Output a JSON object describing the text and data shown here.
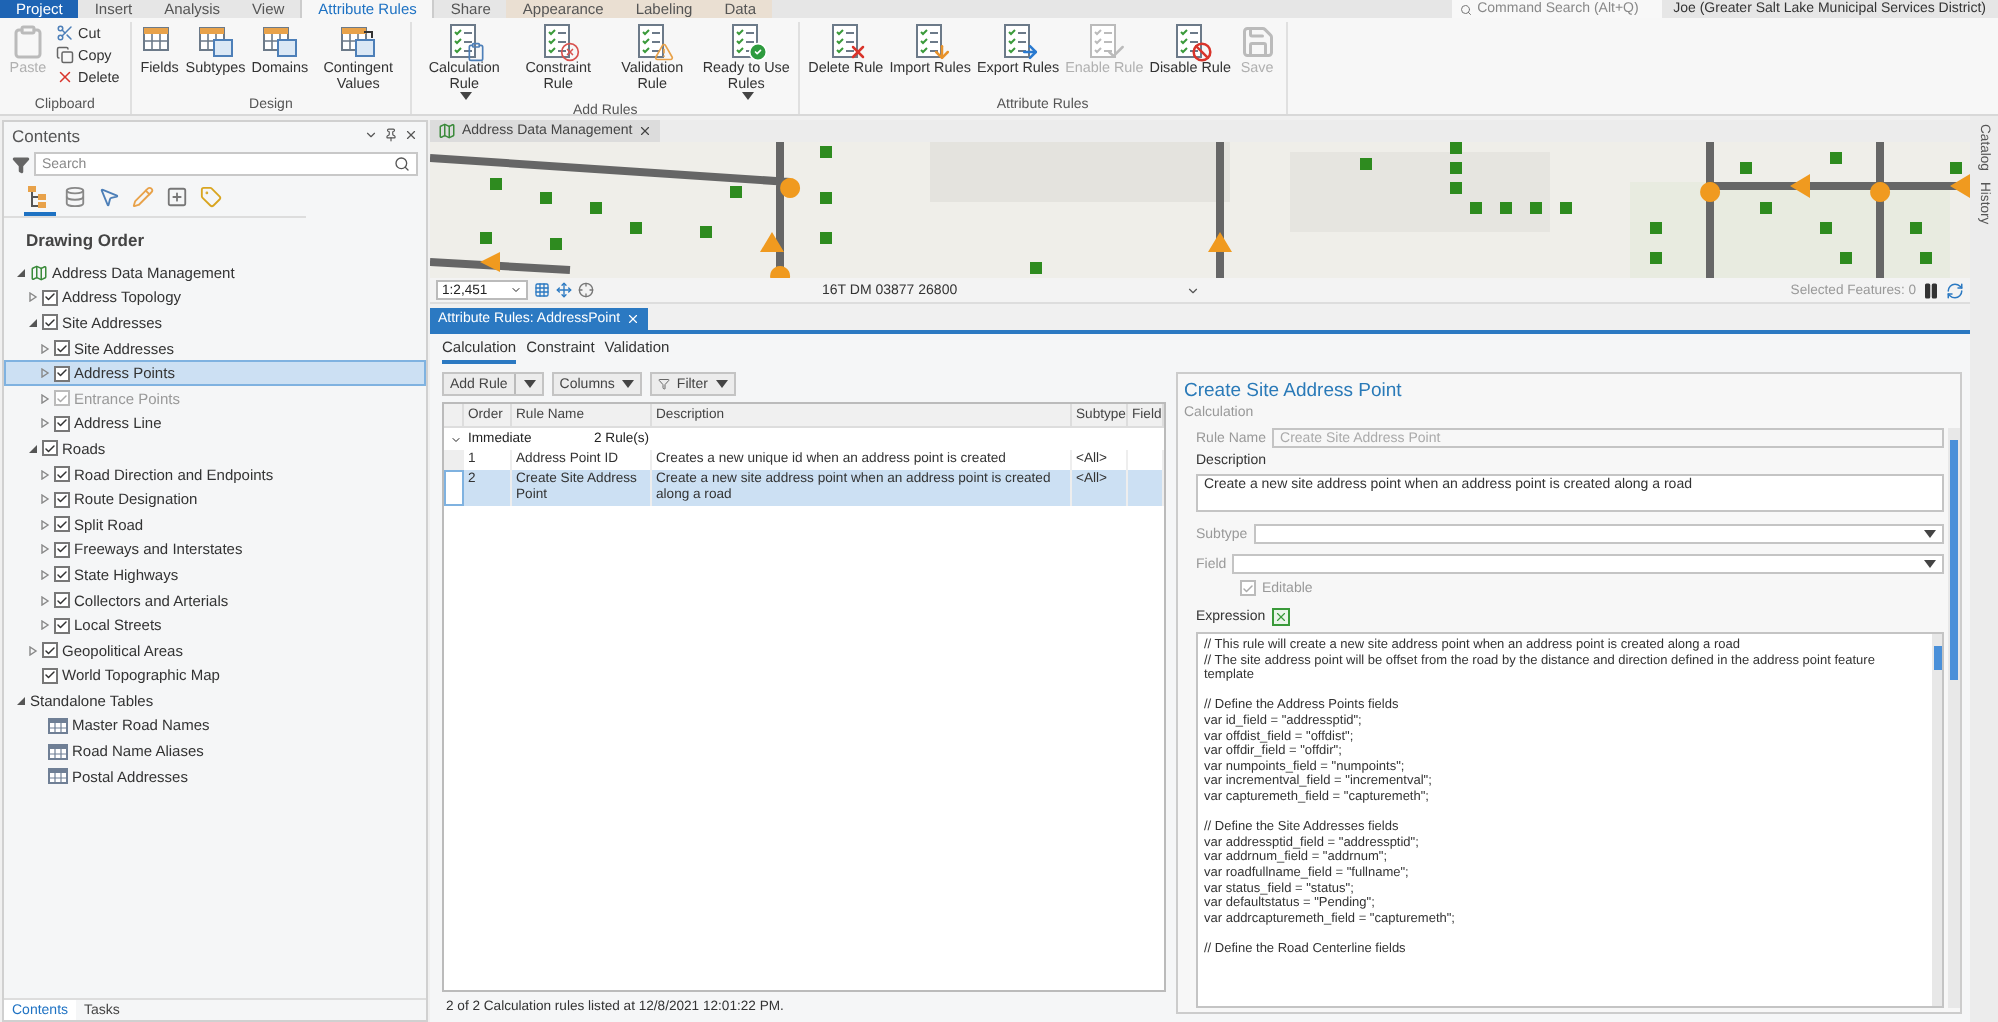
{
  "ribbon_tabs": [
    {
      "label": "Project",
      "kind": "file",
      "selected": false
    },
    {
      "label": "Insert",
      "kind": "core",
      "selected": false
    },
    {
      "label": "Analysis",
      "kind": "core",
      "selected": false
    },
    {
      "label": "View",
      "kind": "core",
      "selected": false
    },
    {
      "label": "Attribute Rules",
      "kind": "core",
      "selected": true
    },
    {
      "label": "Share",
      "kind": "core",
      "selected": false
    },
    {
      "label": "Appearance",
      "kind": "contextual",
      "selected": false
    },
    {
      "label": "Labeling",
      "kind": "contextual",
      "selected": false
    },
    {
      "label": "Data",
      "kind": "contextual",
      "selected": false
    }
  ],
  "command_search": {
    "placeholder": "Command Search (Alt+Q)"
  },
  "account": {
    "name": "Joe (Greater Salt Lake Municipal Services District)"
  },
  "ribbon_groups": [
    {
      "label": "Clipboard",
      "kind": "clipboard",
      "buttons": [
        {
          "label": "Paste",
          "disabled": true
        },
        {
          "label": "Cut",
          "disabled": false
        },
        {
          "label": "Copy",
          "disabled": false
        },
        {
          "label": "Delete",
          "disabled": false
        }
      ]
    },
    {
      "label": "Design",
      "kind": "design",
      "buttons": [
        {
          "label": "Fields",
          "disabled": false,
          "dropdown": false
        },
        {
          "label": "Subtypes",
          "disabled": false,
          "dropdown": false
        },
        {
          "label": "Domains",
          "disabled": false,
          "dropdown": false
        },
        {
          "label": "Contingent Values",
          "disabled": false,
          "dropdown": false
        }
      ]
    },
    {
      "label": "Add Rules",
      "kind": "add_rules",
      "buttons": [
        {
          "label": "Calculation Rule",
          "disabled": false,
          "dropdown": true
        },
        {
          "label": "Constraint Rule",
          "disabled": false,
          "dropdown": false
        },
        {
          "label": "Validation Rule",
          "disabled": false,
          "dropdown": false
        },
        {
          "label": "Ready to Use Rules",
          "disabled": false,
          "dropdown": true
        }
      ]
    },
    {
      "label": "Attribute Rules",
      "kind": "manage_rules",
      "buttons": [
        {
          "label": "Delete Rule",
          "disabled": false,
          "dropdown": false
        },
        {
          "label": "Import Rules",
          "disabled": false,
          "dropdown": false
        },
        {
          "label": "Export Rules",
          "disabled": false,
          "dropdown": false
        },
        {
          "label": "Enable Rule",
          "disabled": true,
          "dropdown": false
        },
        {
          "label": "Disable Rule",
          "disabled": false,
          "dropdown": false
        },
        {
          "label": "Save",
          "disabled": true,
          "dropdown": false
        }
      ]
    }
  ],
  "contents": {
    "title": "Contents",
    "search": {
      "placeholder": "Search"
    },
    "view_tabs": [
      {
        "selected": true
      },
      {
        "selected": false
      },
      {
        "selected": false
      },
      {
        "selected": false
      },
      {
        "selected": false
      },
      {
        "selected": false
      }
    ],
    "heading": "Drawing Order",
    "tree": [
      {
        "label": "Address Data Management",
        "kind": "map",
        "expanded": true,
        "selected": false,
        "children": [
          {
            "label": "Address Topology",
            "expanded": false,
            "checked": true,
            "dimmed": false,
            "selected": false
          },
          {
            "label": "Site Addresses",
            "expanded": true,
            "checked": true,
            "dimmed": false,
            "selected": false,
            "children": [
              {
                "label": "Site Addresses",
                "expanded": false,
                "checked": true,
                "dimmed": false,
                "selected": false
              },
              {
                "label": "Address Points",
                "expanded": false,
                "checked": true,
                "dimmed": false,
                "selected": true
              },
              {
                "label": "Entrance Points",
                "expanded": false,
                "checked": true,
                "dimmed": true,
                "selected": false
              },
              {
                "label": "Address Line",
                "expanded": false,
                "checked": true,
                "dimmed": false,
                "selected": false
              }
            ]
          },
          {
            "label": "Roads",
            "expanded": true,
            "checked": true,
            "dimmed": false,
            "selected": false,
            "children": [
              {
                "label": "Road Direction and Endpoints",
                "expanded": false,
                "checked": true,
                "dimmed": false,
                "selected": false
              },
              {
                "label": "Route Designation",
                "expanded": false,
                "checked": true,
                "dimmed": false,
                "selected": false
              },
              {
                "label": "Split Road",
                "expanded": false,
                "checked": true,
                "dimmed": false,
                "selected": false
              },
              {
                "label": "Freeways and Interstates",
                "expanded": false,
                "checked": true,
                "dimmed": false,
                "selected": false
              },
              {
                "label": "State Highways",
                "expanded": false,
                "checked": true,
                "dimmed": false,
                "selected": false
              },
              {
                "label": "Collectors and Arterials",
                "expanded": false,
                "checked": true,
                "dimmed": false,
                "selected": false
              },
              {
                "label": "Local Streets",
                "expanded": false,
                "checked": true,
                "dimmed": false,
                "selected": false
              }
            ]
          },
          {
            "label": "Geopolitical Areas",
            "expanded": false,
            "checked": true,
            "dimmed": false,
            "selected": false
          },
          {
            "label": "World Topographic Map",
            "checked": true,
            "dimmed": false,
            "selected": false
          }
        ]
      },
      {
        "label": "Standalone Tables",
        "expanded": true,
        "selected": false,
        "children": [
          {
            "label": "Master Road Names",
            "kind": "table",
            "selected": false
          },
          {
            "label": "Road Name Aliases",
            "kind": "table",
            "selected": false
          },
          {
            "label": "Postal Addresses",
            "kind": "table",
            "selected": false
          }
        ]
      }
    ],
    "bottom_tabs": [
      {
        "label": "Contents",
        "selected": true
      },
      {
        "label": "Tasks",
        "selected": false
      }
    ]
  },
  "map_view": {
    "tab_title": "Address Data Management",
    "scale": "1:2,451",
    "coordinates": "16T DM 03877 26800",
    "selected_features": "Selected Features: 0"
  },
  "side_tabs": [
    "Catalog",
    "History"
  ],
  "rules_pane": {
    "tab_title": "Attribute Rules: AddressPoint",
    "tabs": [
      {
        "label": "Calculation",
        "selected": true
      },
      {
        "label": "Constraint",
        "selected": false
      },
      {
        "label": "Validation",
        "selected": false
      }
    ],
    "toolbar": [
      {
        "label": "Add Rule",
        "kind": "split"
      },
      {
        "label": "Columns",
        "kind": "dropdown"
      },
      {
        "label": "Filter",
        "kind": "filter"
      }
    ],
    "columns": [
      "Order",
      "Rule Name",
      "Description",
      "Subtype",
      "Field"
    ],
    "group": {
      "label": "Immediate",
      "count": "2 Rule(s)",
      "expanded": true
    },
    "rows": [
      {
        "order": "1",
        "name": "Address Point ID",
        "description": "Creates a new unique id when an address point is created",
        "subtype": "<All>",
        "selected": false
      },
      {
        "order": "2",
        "name": "Create Site Address Point",
        "description": "Create a new site address point when an address point is created along a road",
        "subtype": "<All>",
        "selected": true
      }
    ],
    "status": "2 of 2 Calculation rules listed at 12/8/2021 12:01:22 PM."
  },
  "rule_detail": {
    "title": "Create Site Address Point",
    "subtitle": "Calculation",
    "rule_name": {
      "label": "Rule Name",
      "value": "Create Site Address Point",
      "disabled": true
    },
    "description": {
      "label": "Description",
      "value": "Create a new site address point when an address point is created along a road",
      "disabled": false
    },
    "subtype": {
      "label": "Subtype",
      "disabled": true
    },
    "field": {
      "label": "Field",
      "disabled": true
    },
    "editable": {
      "label": "Editable",
      "checked": true,
      "disabled": true
    },
    "expression": {
      "label": "Expression",
      "code": "// This rule will create a new site address point when an address point is created along a road\n// The site address point will be offset from the road by the distance and direction defined in the address point feature template\n\n// Define the Address Points fields\nvar id_field = \"addressptid\";\nvar offdist_field = \"offdist\";\nvar offdir_field = \"offdir\";\nvar numpoints_field = \"numpoints\";\nvar incrementval_field = \"incrementval\";\nvar capturemeth_field = \"capturemeth\";\n\n// Define the Site Addresses fields\nvar addressptid_field = \"addressptid\";\nvar addrnum_field = \"addrnum\";\nvar roadfullname_field = \"fullname\";\nvar status_field = \"status\";\nvar defaultstatus = \"Pending\";\nvar addrcapturemeth_field = \"capturemeth\";\n\n// Define the Road Centerline fields"
    }
  }
}
